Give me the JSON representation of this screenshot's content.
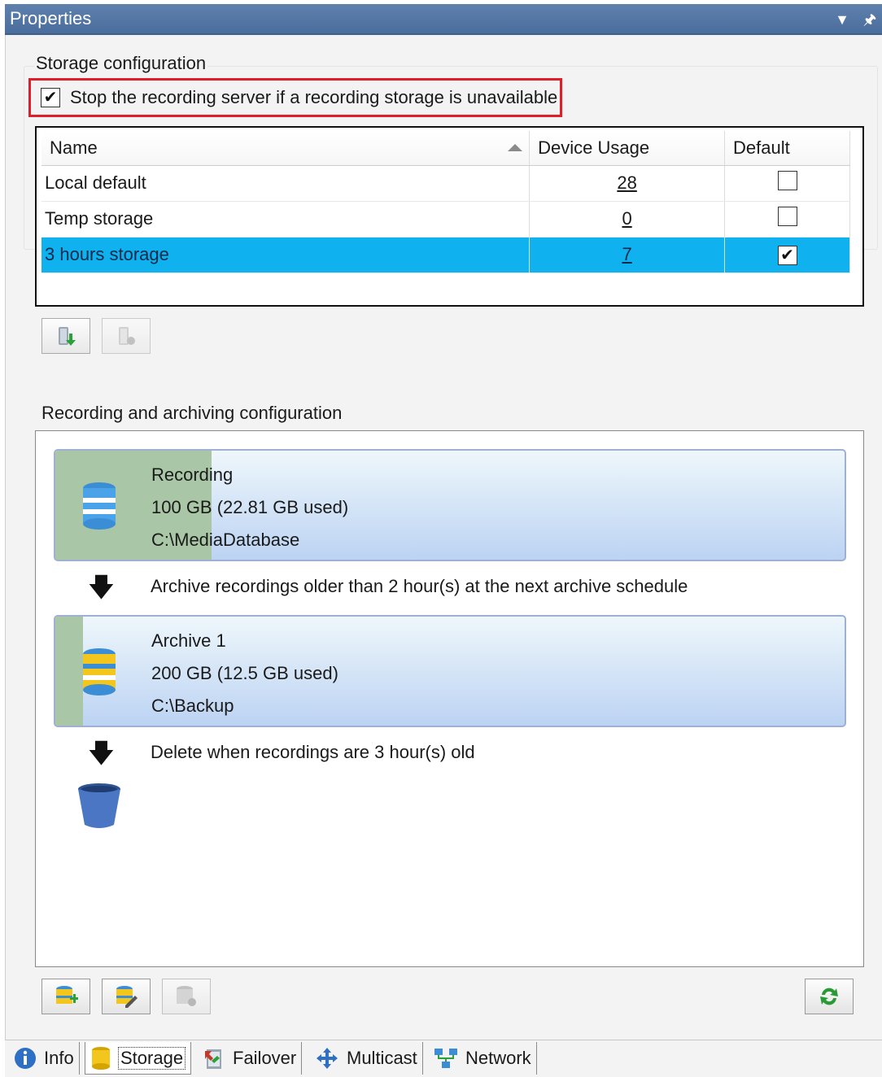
{
  "window": {
    "title": "Properties"
  },
  "storage_config": {
    "group_label": "Storage configuration",
    "stop_checkbox_label": "Stop the recording server if a recording storage is unavailable",
    "stop_checkbox_checked": true,
    "columns": [
      "Name",
      "Device Usage",
      "Default"
    ],
    "rows": [
      {
        "name": "Local default",
        "device_usage": "28",
        "default": false,
        "selected": false
      },
      {
        "name": "Temp storage",
        "device_usage": "0",
        "default": false,
        "selected": false
      },
      {
        "name": "3 hours storage",
        "device_usage": "7",
        "default": true,
        "selected": true
      }
    ]
  },
  "recording_config": {
    "group_label": "Recording and archiving configuration",
    "recording": {
      "title": "Recording",
      "size": "100 GB (22.81 GB used)",
      "path": "C:\\MediaDatabase"
    },
    "archive_step": "Archive recordings older than 2 hour(s) at the next archive schedule",
    "archive": {
      "title": "Archive 1",
      "size": "200 GB (12.5 GB used)",
      "path": "C:\\Backup"
    },
    "delete_step": "Delete when recordings are 3 hour(s) old"
  },
  "tabs": [
    {
      "label": "Info",
      "icon": "info-icon",
      "active": false
    },
    {
      "label": "Storage",
      "icon": "storage-icon",
      "active": true
    },
    {
      "label": "Failover",
      "icon": "failover-icon",
      "active": false
    },
    {
      "label": "Multicast",
      "icon": "multicast-icon",
      "active": false
    },
    {
      "label": "Network",
      "icon": "network-icon",
      "active": false
    }
  ],
  "colors": {
    "title_bar": "#5477a6",
    "selected_row": "#0fb1ef",
    "highlight_border": "#e21d2a"
  }
}
